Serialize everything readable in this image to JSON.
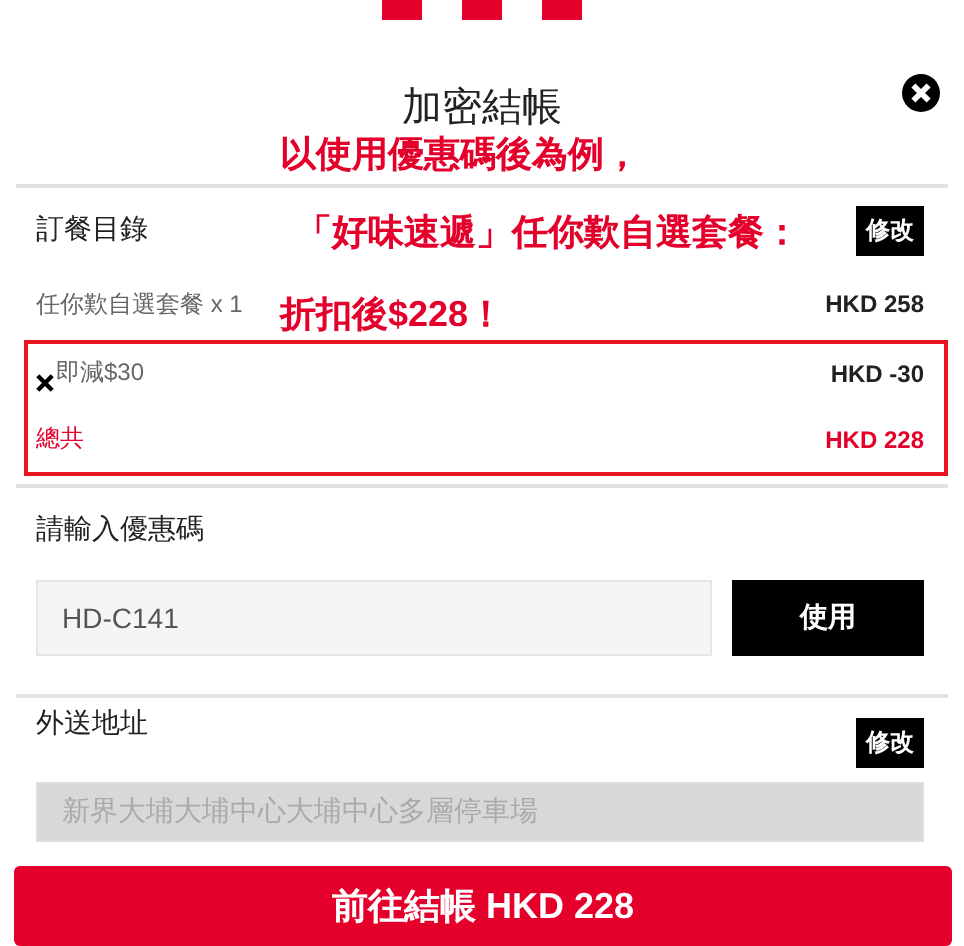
{
  "title": "加密結帳",
  "order": {
    "label": "訂餐目錄",
    "edit_button": "修改",
    "items": [
      {
        "kind": "item",
        "name": "任你歎自選套餐 x 1",
        "price": "HKD 258"
      },
      {
        "kind": "discount",
        "name": "即減$30",
        "price": "HKD -30"
      },
      {
        "kind": "total",
        "name": "總共",
        "price": "HKD 228"
      }
    ]
  },
  "coupon": {
    "label": "請輸入優惠碼",
    "value": "HD-C141",
    "button": "使用"
  },
  "address": {
    "label": "外送地址",
    "edit_button": "修改",
    "value": "新界大埔大埔中心大埔中心多層停車場",
    "disabled": true
  },
  "checkout_button": "前往結帳 HKD 228",
  "annotations": [
    "以使用優惠碼後為例，",
    "「好味速遞」任你歎自選套餐：",
    "折扣後$228！"
  ]
}
